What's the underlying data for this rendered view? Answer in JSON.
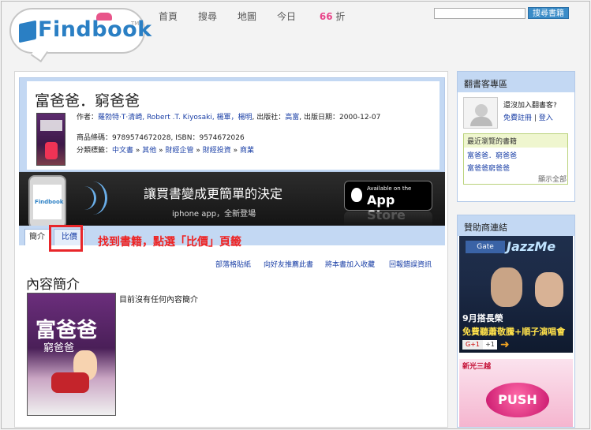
{
  "logo": {
    "text": "Findbook",
    "tm": "TM"
  },
  "nav": {
    "home": "首頁",
    "search": "搜尋",
    "map": "地圖",
    "deal_prefix": "今日",
    "deal_value": "66",
    "deal_suffix": "折"
  },
  "top_search": {
    "placeholder": "",
    "button": "搜尋書籍"
  },
  "book": {
    "title": "富爸爸．窮爸爸",
    "author_label": "作者：",
    "authors": "羅勃特·T·清崎, Robert .T. Kiyosaki, 楊軍，楊明",
    "publisher_label": ", 出版社：",
    "publisher": "高富",
    "pubdate_label": ", 出版日期：",
    "pubdate": "2000-12-07",
    "code_label": "商品條碼：",
    "code": "9789574672028",
    "isbn_label": ", ISBN：",
    "isbn": "9574672026",
    "category_label": "分類標籤：",
    "categories": [
      "中文書",
      "其他",
      "財經企管",
      "財經投資",
      "商業"
    ],
    "cat_sep": " » "
  },
  "banner": {
    "main": "讓買書變成更簡單的決定",
    "sub": "iphone app，全新登場",
    "store_small": "Available on the",
    "store_big": "App Store",
    "phone_logo": "Findbook"
  },
  "tabs": {
    "intro": "簡介",
    "price": "比價"
  },
  "annotation": "找到書籍，點選「比價」頁籤",
  "actions": [
    "部落格貼紙",
    "向好友推薦此書",
    "將本書加入收藏",
    "回報錯誤資訊"
  ],
  "section_title": "內容簡介",
  "cover_text": {
    "c1": "富爸爸",
    "c2": "窮爸爸"
  },
  "no_description": "目前沒有任何內容簡介",
  "reader_zone": {
    "title": "翻書客專區",
    "join_question": "還沒加入翻書客?",
    "register": "免費註冊",
    "sep": " | ",
    "login": "登入",
    "recent_title": "最近瀏覽的書籍",
    "recent_items": [
      "富爸爸．窮爸爸",
      "富爸爸窮爸爸"
    ],
    "show_all": "顯示全部"
  },
  "sponsor": {
    "title": "贊助商連結",
    "ad1": {
      "gate": "Gate",
      "jazz": "JazzMe",
      "line1": "9月搭長榮",
      "line2": "免費聽蕭敬騰+順子演唱會",
      "gplus": "G+1",
      "gplus_count": "+1"
    },
    "ad2": {
      "name": "新光三越",
      "button": "PUSH"
    }
  }
}
